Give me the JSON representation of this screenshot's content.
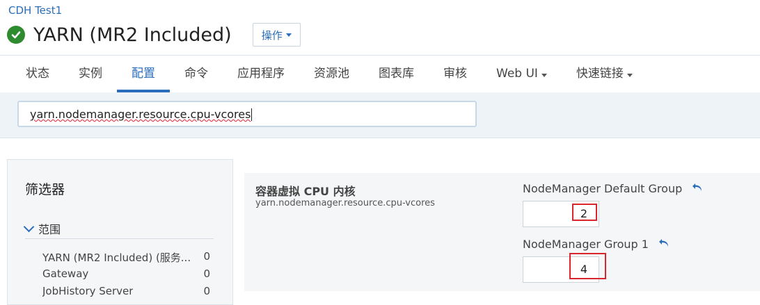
{
  "header": {
    "cluster_name": "CDH Test1",
    "service_title": "YARN (MR2 Included)",
    "actions_label": "操作"
  },
  "tabs": [
    {
      "label": "状态"
    },
    {
      "label": "实例"
    },
    {
      "label": "配置",
      "active": true
    },
    {
      "label": "命令"
    },
    {
      "label": "应用程序"
    },
    {
      "label": "资源池"
    },
    {
      "label": "图表库"
    },
    {
      "label": "审核"
    },
    {
      "label": "Web UI",
      "dropdown": true
    },
    {
      "label": "快速链接",
      "dropdown": true
    }
  ],
  "search": {
    "value": "yarn.nodemanager.resource.cpu-vcores"
  },
  "filter": {
    "title": "筛选器",
    "scope_label": "范围",
    "items": [
      {
        "name": "YARN (MR2 Included) (服务...",
        "count": "0"
      },
      {
        "name": "Gateway",
        "count": "0"
      },
      {
        "name": "JobHistory Server",
        "count": "0"
      }
    ]
  },
  "property": {
    "display_name": "容器虚拟 CPU 内核",
    "key": "yarn.nodemanager.resource.cpu-vcores",
    "groups": [
      {
        "name": "NodeManager Default Group",
        "value": "2"
      },
      {
        "name": "NodeManager Group 1",
        "value": "4"
      }
    ]
  },
  "colors": {
    "accent": "#2a6ebb",
    "status_ok": "#2e8b2e",
    "highlight": "#d9262c"
  },
  "icons": {
    "status": "check-circle-icon",
    "undo": "undo-arrow-icon",
    "scope_toggle": "chevron-down-icon"
  }
}
